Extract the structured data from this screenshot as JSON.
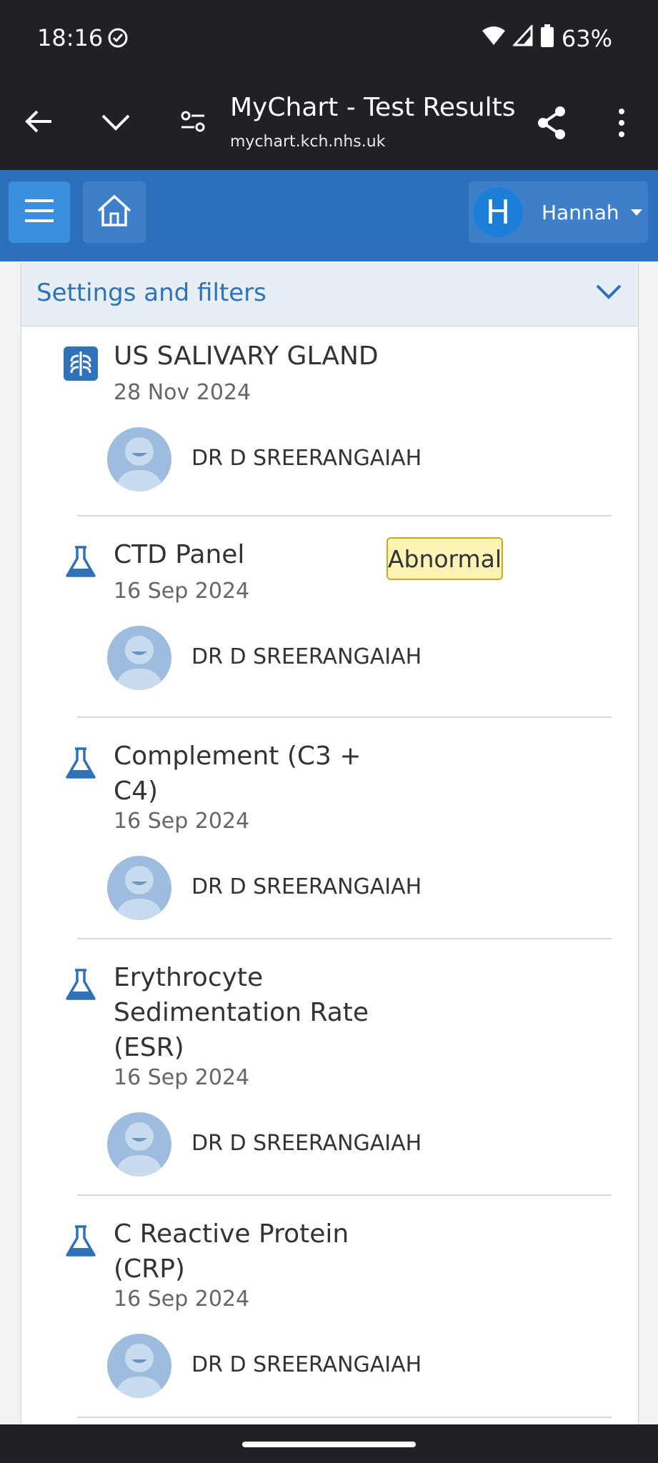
{
  "status_bar": {
    "time": "18:16",
    "battery": "63%"
  },
  "browser": {
    "title": "MyChart - Test Results",
    "url": "mychart.kch.nhs.uk"
  },
  "header": {
    "user_initial": "H",
    "user_name": "Hannah"
  },
  "filters": {
    "label": "Settings and filters"
  },
  "results": [
    {
      "title": "US SALIVARY GLAND",
      "date": "28 Nov 2024",
      "provider": "DR D SREERANGAIAH",
      "icon": "imaging-icon",
      "badge": ""
    },
    {
      "title": "CTD Panel",
      "date": "16 Sep 2024",
      "provider": "DR D SREERANGAIAH",
      "icon": "lab-flask-icon",
      "badge": "Abnormal"
    },
    {
      "title": "Complement (C3 + C4)",
      "date": "16 Sep 2024",
      "provider": "DR D SREERANGAIAH",
      "icon": "lab-flask-icon",
      "badge": ""
    },
    {
      "title": "Erythrocyte Sedimentation Rate (ESR)",
      "date": "16 Sep 2024",
      "provider": "DR D SREERANGAIAH",
      "icon": "lab-flask-icon",
      "badge": ""
    },
    {
      "title": "C Reactive Protein (CRP)",
      "date": "16 Sep 2024",
      "provider": "DR D SREERANGAIAH",
      "icon": "lab-flask-icon",
      "badge": ""
    }
  ],
  "colors": {
    "header_blue": "#2c6fba",
    "link_blue": "#2c73b8",
    "abnormal_bg": "#fdf3b4",
    "abnormal_border": "#c6a92b"
  }
}
